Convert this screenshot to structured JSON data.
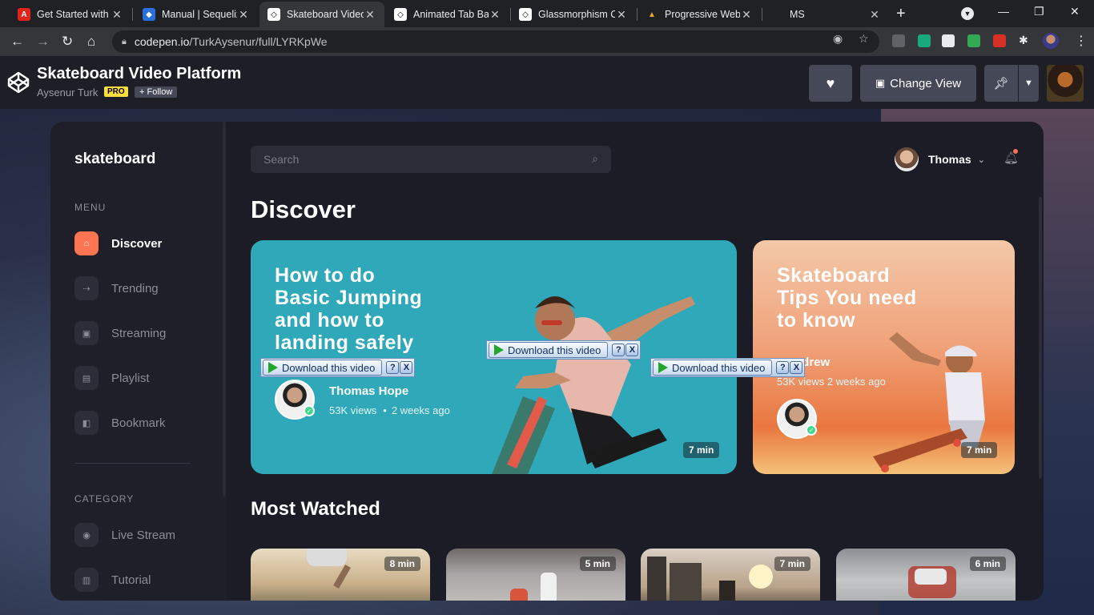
{
  "browser": {
    "tabs": [
      {
        "title": "Get Started with A",
        "icon": "adobe-icon"
      },
      {
        "title": "Manual | Sequeliz",
        "icon": "sequelize-icon"
      },
      {
        "title": "Skateboard Video",
        "icon": "codepen-icon"
      },
      {
        "title": "Animated Tab Bar",
        "icon": "codepen-icon"
      },
      {
        "title": "Glassmorphism C",
        "icon": "codepen-icon"
      },
      {
        "title": "Progressive Web",
        "icon": "pwa-icon"
      },
      {
        "title": "MS",
        "icon": ""
      }
    ],
    "active_tab": 2,
    "url_host": "codepen.io",
    "url_path": "/TurkAysenur/full/LYRKpWe"
  },
  "codepen": {
    "title": "Skateboard Video Platform",
    "author": "Aysenur Turk",
    "pro_badge": "PRO",
    "follow_label": "+ Follow",
    "change_view_label": "Change View"
  },
  "app": {
    "brand": "skateboard",
    "menu_label": "MENU",
    "menu": [
      {
        "label": "Discover",
        "icon": "home-icon",
        "active": true
      },
      {
        "label": "Trending",
        "icon": "trending-icon",
        "active": false
      },
      {
        "label": "Streaming",
        "icon": "streaming-icon",
        "active": false
      },
      {
        "label": "Playlist",
        "icon": "playlist-icon",
        "active": false
      },
      {
        "label": "Bookmark",
        "icon": "bookmark-icon",
        "active": false
      }
    ],
    "category_label": "CATEGORY",
    "categories": [
      {
        "label": "Live Stream",
        "icon": "live-stream-icon"
      },
      {
        "label": "Tutorial",
        "icon": "tutorial-icon"
      }
    ],
    "search_placeholder": "Search",
    "user_name": "Thomas",
    "discover_title": "Discover",
    "featured": [
      {
        "title_lines": [
          "How to do",
          "Basic Jumping",
          "and how to",
          "landing safely"
        ],
        "author": "Thomas Hope",
        "views": "53K views",
        "time": "2 weeks ago",
        "duration": "7 min"
      },
      {
        "title_lines": [
          "Skateboard",
          "Tips You need",
          "to know"
        ],
        "author_partial": "ndrew",
        "meta": "53K views 2 weeks ago",
        "duration": "7 min"
      }
    ],
    "most_watched_title": "Most Watched",
    "most_watched_durations": [
      "8 min",
      "5 min",
      "7 min",
      "6 min"
    ],
    "download_label": "Download this video",
    "download_help": "?",
    "download_close": "X",
    "accent_color": "#ff7551",
    "featured_color": "#2fa9b9"
  }
}
